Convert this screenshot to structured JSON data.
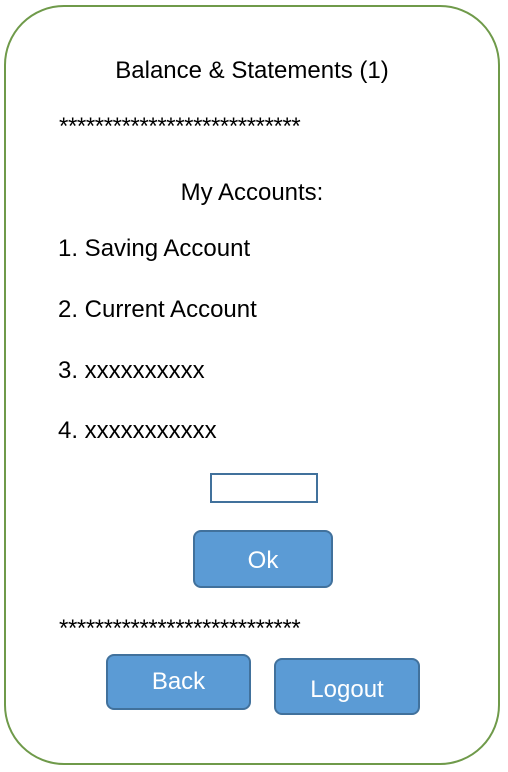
{
  "screen": {
    "title": "Balance & Statements (1)",
    "separator_top": "***************************",
    "accounts_heading": "My Accounts:",
    "accounts": [
      "1. Saving Account",
      "2. Current Account",
      "3. xxxxxxxxxx",
      "4. xxxxxxxxxxx"
    ],
    "selection_input": {
      "value": "",
      "placeholder": ""
    },
    "ok_label": "Ok",
    "separator_bottom": "***************************",
    "back_label": "Back",
    "logout_label": "Logout"
  },
  "colors": {
    "frame_border": "#6f9a4a",
    "button_fill": "#5b9bd5",
    "button_border": "#41719c",
    "button_text": "#ffffff"
  }
}
